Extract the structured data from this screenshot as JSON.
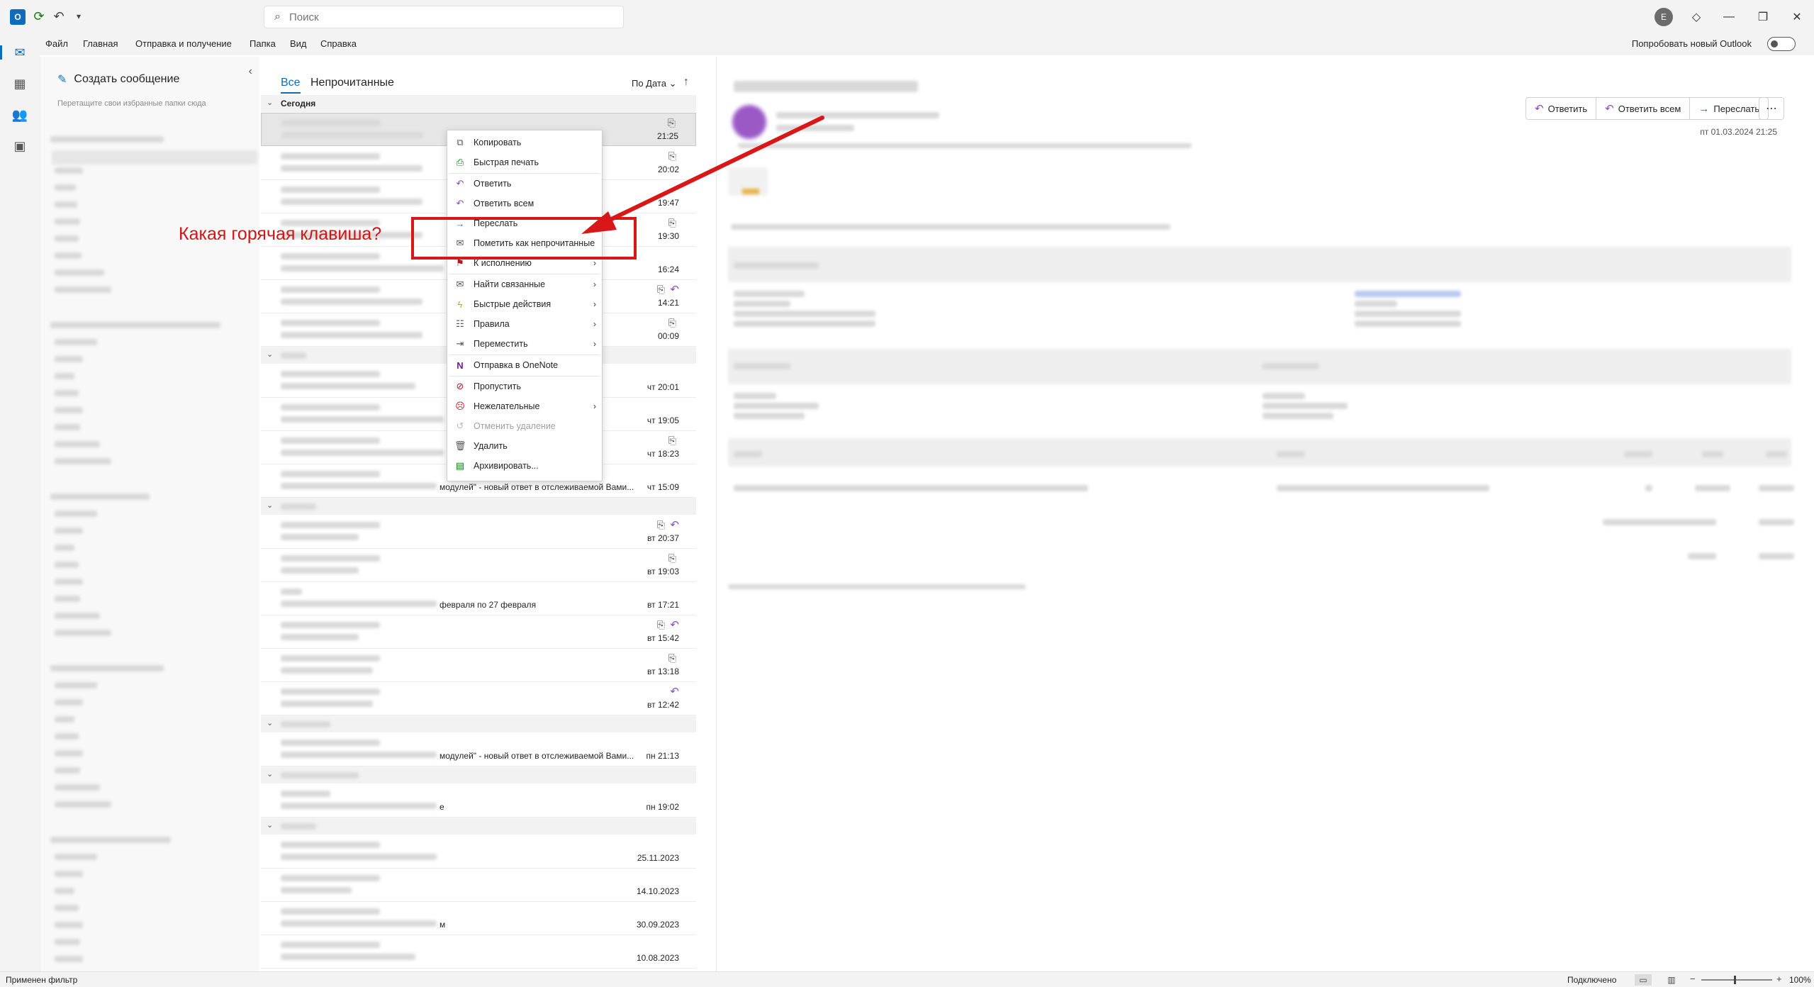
{
  "window": {
    "app_icon_letter": "O"
  },
  "search": {
    "placeholder": "Поиск"
  },
  "user": {
    "avatar_initial": "E"
  },
  "menu": {
    "items": [
      "Файл",
      "Главная",
      "Отправка и получение",
      "Папка",
      "Вид",
      "Справка"
    ],
    "try_new": "Попробовать новый Outlook"
  },
  "folder_pane": {
    "new_message": "Создать сообщение",
    "favorites_hint": "Перетащите свои избранные папки сюда"
  },
  "list": {
    "tab_all": "Все",
    "tab_unread": "Непрочитанные",
    "sort_label": "По Дата",
    "group_today": "Сегодня",
    "times": {
      "t1": "21:25",
      "t2": "20:02",
      "t3": "19:47",
      "t4": "19:30",
      "t5": "16:24",
      "t6": "14:21",
      "t7": "00:09",
      "t8": "чт 20:01",
      "t9": "чт 19:05",
      "t10": "чт 18:23",
      "t11": "чт 15:09",
      "t12": "вт 20:37",
      "t13": "вт 19:03",
      "t14": "вт 17:21",
      "t15": "вт 15:42",
      "t16": "вт 13:18",
      "t17": "вт 12:42",
      "t18": "пн 21:13",
      "t19": "пн 19:02",
      "t20": "25.11.2023",
      "t21": "14.10.2023",
      "t22": "30.09.2023",
      "t23": "10.08.2023"
    },
    "previews": {
      "p1": "модулей\" - новый ответ в отслеживаемой Вами...",
      "p2": "февраля по 27 февраля",
      "p3": "модулей\" - новый ответ в отслеживаемой Вами...",
      "p4": "е",
      "p5": "м"
    }
  },
  "reading": {
    "reply": "Ответить",
    "reply_all": "Ответить всем",
    "forward": "Переслать",
    "date": "пт 01.03.2024 21:25"
  },
  "context_menu": {
    "copy": "Копировать",
    "quick_print": "Быстрая печать",
    "reply": "Ответить",
    "reply_all": "Ответить всем",
    "forward": "Переслать",
    "mark_unread": "Пометить как непрочитанные",
    "followup": "К исполнению",
    "find_related": "Найти связанные",
    "quick_steps": "Быстрые действия",
    "rules": "Правила",
    "move": "Переместить",
    "onenote": "Отправка в OneNote",
    "ignore": "Пропустить",
    "junk": "Нежелательные",
    "undo_delete": "Отменить удаление",
    "delete": "Удалить",
    "archive": "Архивировать..."
  },
  "annotation": {
    "question": "Какая горячая клавиша?"
  },
  "status": {
    "filter": "Применен фильтр",
    "connection": "Подключено",
    "zoom": "100%"
  },
  "colors": {
    "accent": "#0f6cbd",
    "annotation": "#d81818",
    "reply_icon": "#8c4bbf"
  }
}
